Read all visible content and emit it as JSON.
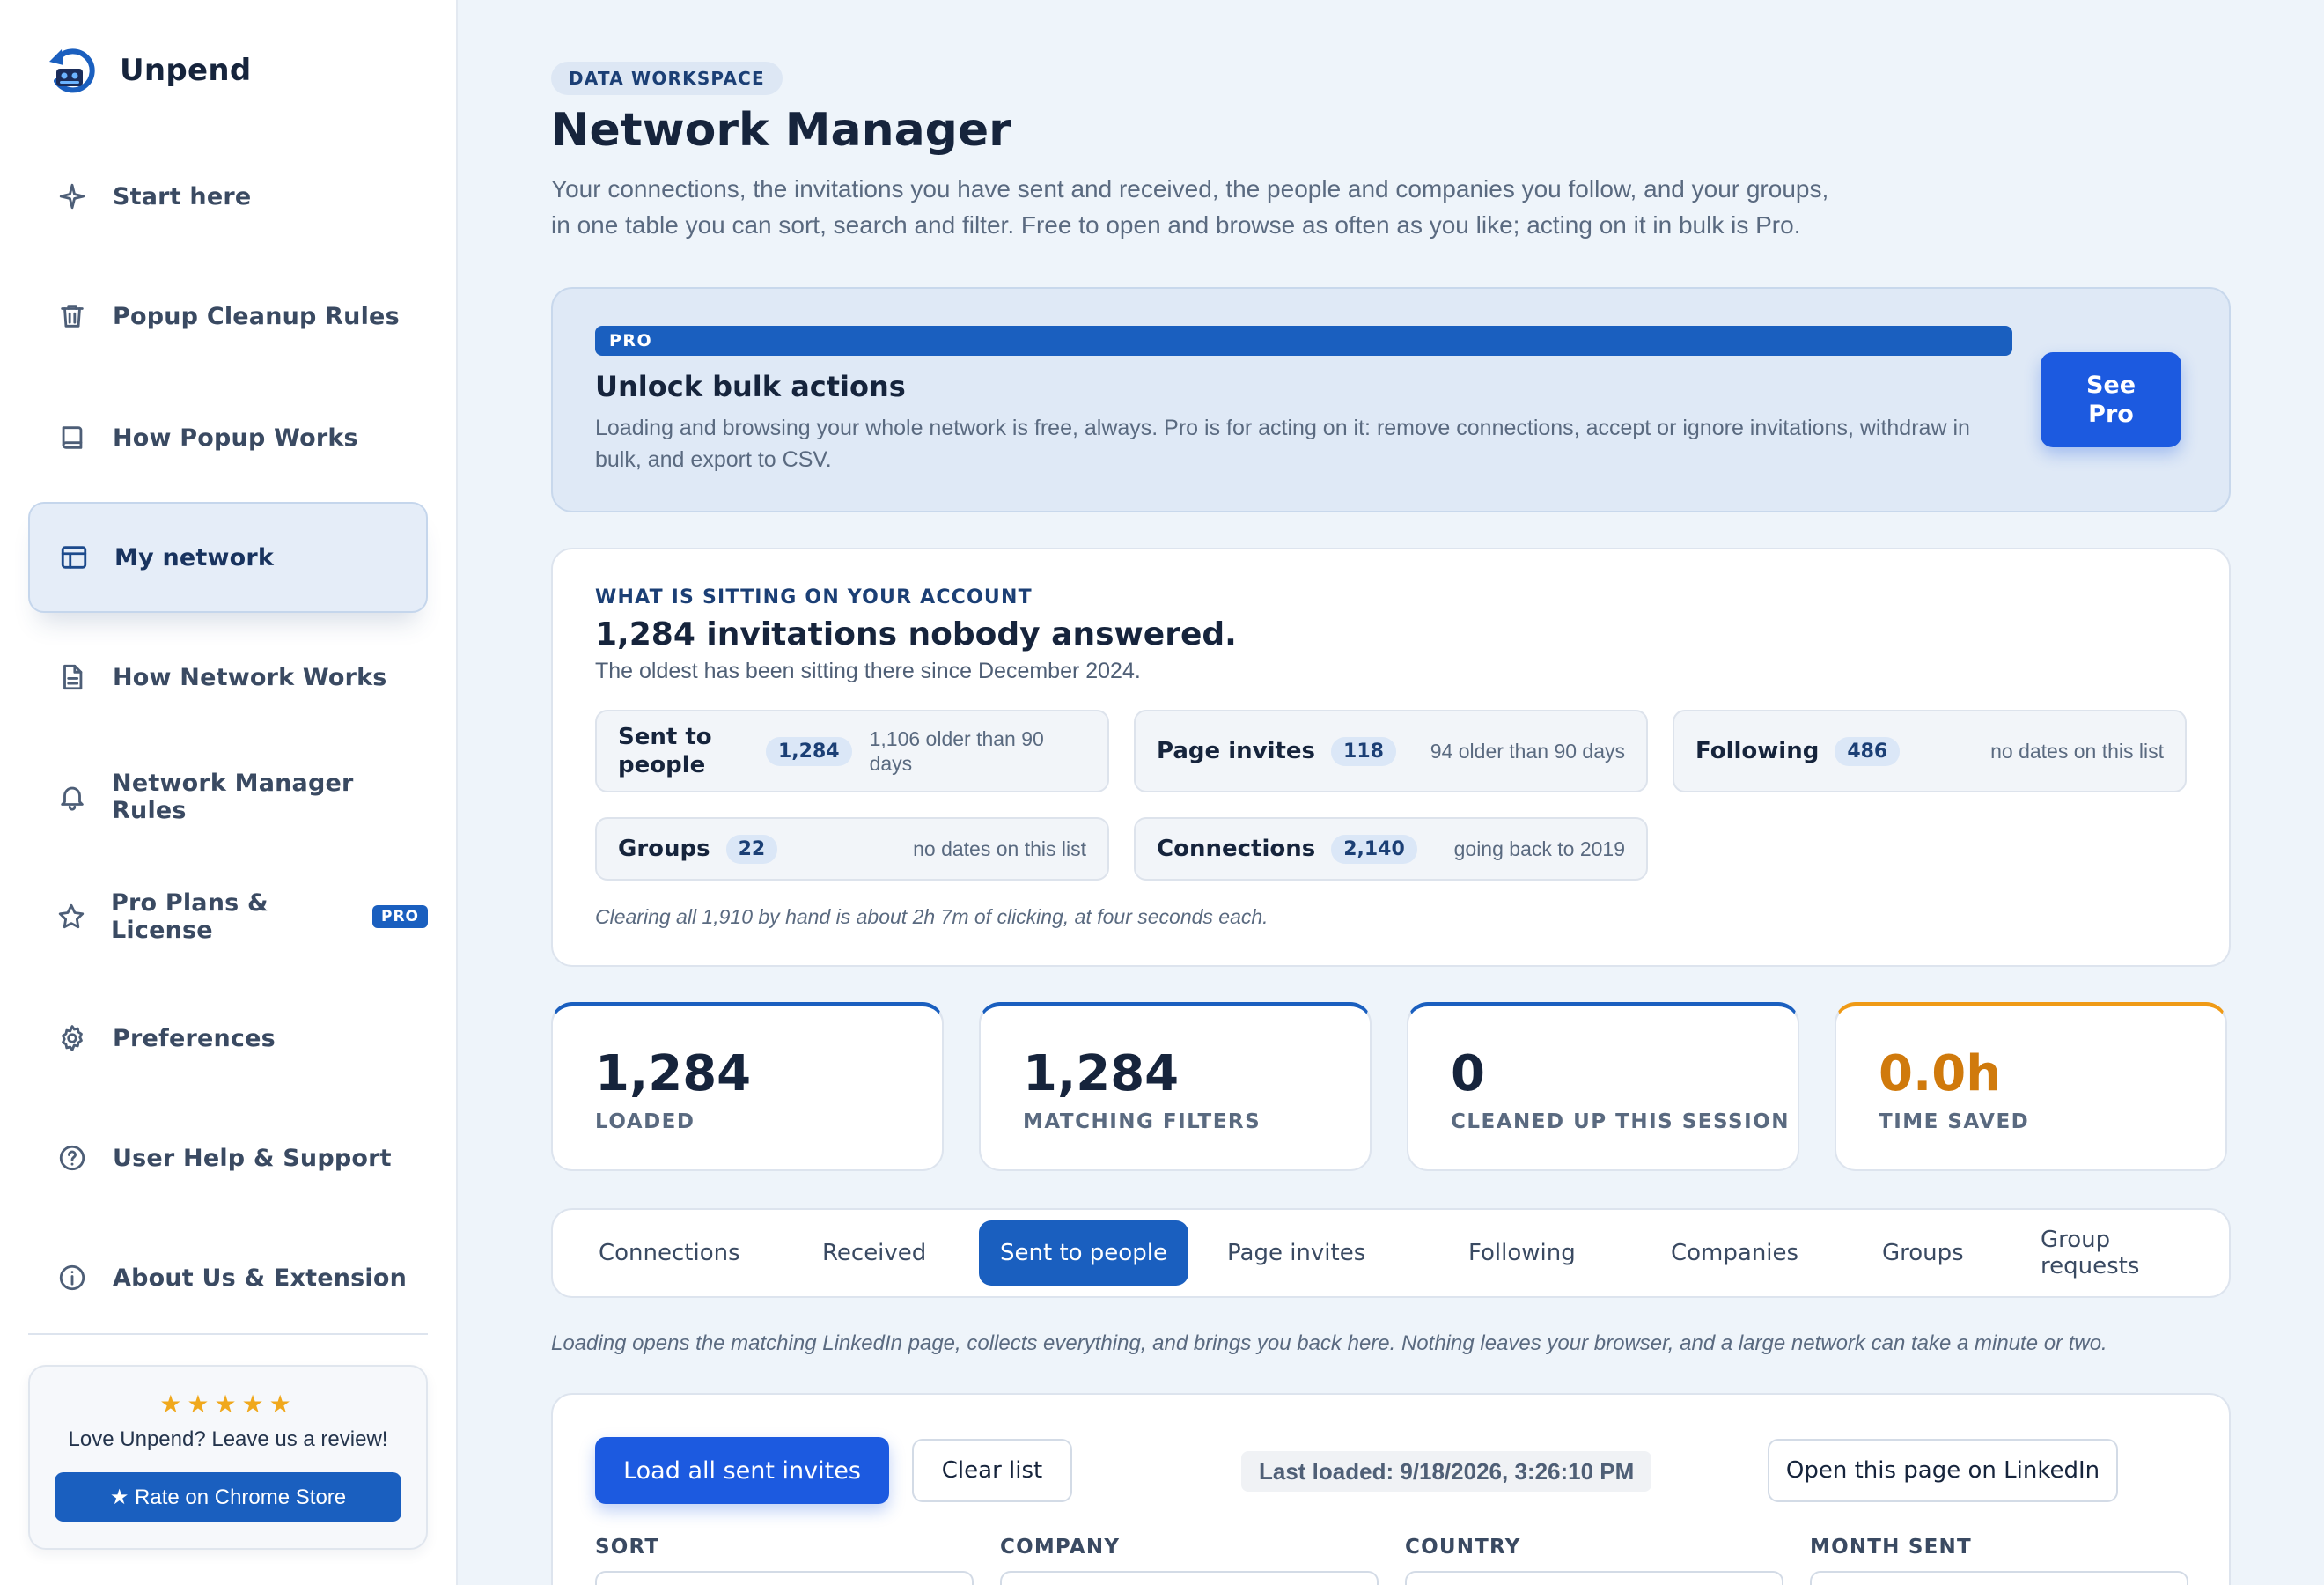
{
  "app": {
    "name": "Unpend"
  },
  "sidebar": {
    "items": [
      {
        "label": "Start here",
        "icon": "sparkle-icon"
      },
      {
        "label": "Popup Cleanup Rules",
        "icon": "trash-icon"
      },
      {
        "label": "How Popup Works",
        "icon": "book-icon"
      },
      {
        "label": "My network",
        "icon": "layout-icon",
        "active": true
      },
      {
        "label": "How Network Works",
        "icon": "document-icon"
      },
      {
        "label": "Network Manager Rules",
        "icon": "bell-icon"
      },
      {
        "label": "Pro Plans & License",
        "icon": "star-icon",
        "badge": "PRO"
      },
      {
        "label": "Preferences",
        "icon": "gear-icon"
      },
      {
        "label": "User Help & Support",
        "icon": "help-circle-icon"
      },
      {
        "label": "About Us & Extension",
        "icon": "info-circle-icon"
      }
    ],
    "review": {
      "stars": "★★★★★",
      "text": "Love Unpend? Leave us a review!",
      "button": "★ Rate on Chrome Store"
    }
  },
  "header": {
    "tag": "DATA WORKSPACE",
    "title": "Network Manager",
    "description": "Your connections, the invitations you have sent and received, the people and companies you follow, and your groups, in one table you can sort, search and filter. Free to open and browse as often as you like; acting on it in bulk is Pro."
  },
  "pro_banner": {
    "badge": "PRO",
    "title": "Unlock bulk actions",
    "description": "Loading and browsing your whole network is free, always. Pro is for acting on it: remove connections, accept or ignore invitations, withdraw in bulk, and export to CSV.",
    "button": "See Pro"
  },
  "account": {
    "eyebrow": "WHAT IS SITTING ON YOUR ACCOUNT",
    "headline": "1,284 invitations nobody answered.",
    "subtext": "The oldest has been sitting there since December 2024.",
    "stats": [
      {
        "label": "Sent to people",
        "count": "1,284",
        "note": "1,106 older than 90 days"
      },
      {
        "label": "Page invites",
        "count": "118",
        "note": "94 older than 90 days"
      },
      {
        "label": "Following",
        "count": "486",
        "note": "no dates on this list"
      },
      {
        "label": "Groups",
        "count": "22",
        "note": "no dates on this list"
      },
      {
        "label": "Connections",
        "count": "2,140",
        "note": "going back to 2019"
      }
    ],
    "footnote": "Clearing all 1,910 by hand is about 2h 7m of clicking, at four seconds each."
  },
  "metrics": [
    {
      "value": "1,284",
      "label": "LOADED"
    },
    {
      "value": "1,284",
      "label": "MATCHING FILTERS"
    },
    {
      "value": "0",
      "label": "CLEANED UP THIS SESSION"
    },
    {
      "value": "0.0h",
      "label": "TIME SAVED"
    }
  ],
  "tabs": [
    {
      "label": "Connections"
    },
    {
      "label": "Received"
    },
    {
      "label": "Sent to people",
      "active": true
    },
    {
      "label": "Page invites"
    },
    {
      "label": "Following"
    },
    {
      "label": "Companies"
    },
    {
      "label": "Groups"
    },
    {
      "label": "Group requests"
    }
  ],
  "loading_note": "Loading opens the matching LinkedIn page, collects everything, and brings you back here. Nothing leaves your browser, and a large network can take a minute or two.",
  "list": {
    "load_button": "Load all sent invites",
    "clear_button": "Clear list",
    "last_loaded": "Last loaded: 9/18/2026, 3:26:10 PM",
    "open_button": "Open this page on LinkedIn",
    "filters": [
      "SORT",
      "COMPANY",
      "COUNTRY",
      "MONTH SENT"
    ]
  },
  "colors": {
    "accent": "#1a5fbf",
    "primary_button": "#1c5ae0",
    "amber": "#ef9a16",
    "star": "#f0a81c"
  }
}
